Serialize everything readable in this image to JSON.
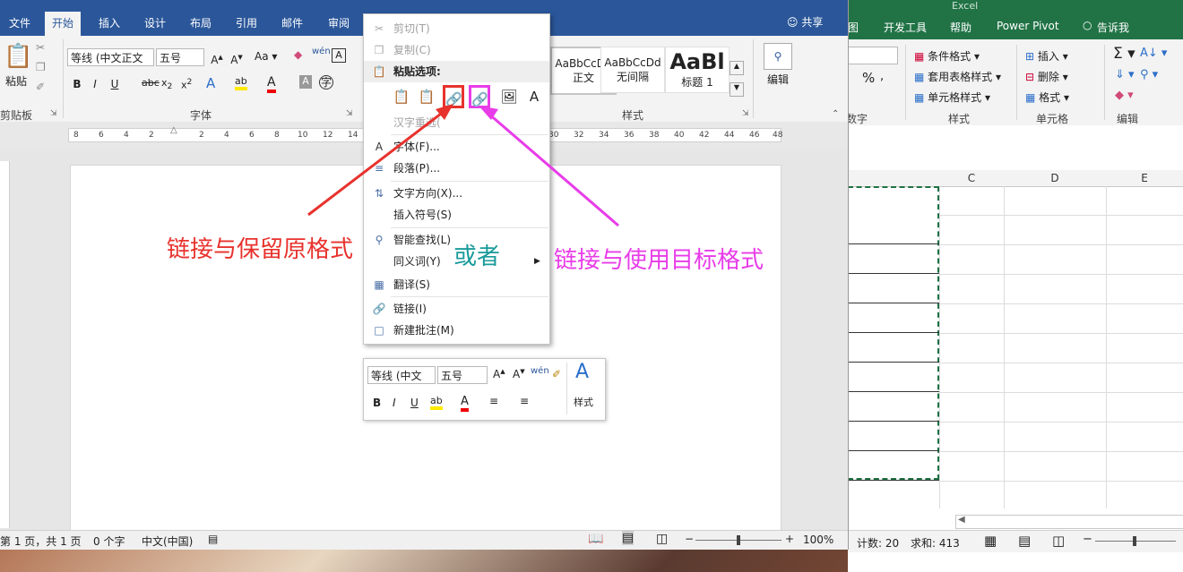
{
  "excel": {
    "tabs": [
      "图",
      "开发工具",
      "帮助",
      "Power Pivot",
      "告诉我"
    ],
    "title_fragment": "Excel",
    "ribbon": {
      "percent_symbol": "%",
      "number_group_label": "数字",
      "styles": {
        "conditional": "条件格式",
        "table_style": "套用表格样式",
        "cell_style": "单元格样式",
        "label": "样式"
      },
      "cells": {
        "insert": "插入",
        "delete": "删除",
        "format": "格式",
        "label": "单元格"
      },
      "editing": {
        "label": "编辑"
      }
    },
    "columns": [
      "C",
      "D",
      "E"
    ],
    "status": {
      "count": "计数: 20",
      "sum": "求和: 413"
    }
  },
  "word": {
    "tabs": [
      "文件",
      "开始",
      "插入",
      "设计",
      "布局",
      "引用",
      "邮件",
      "审阅"
    ],
    "share": "共享",
    "clipboard": {
      "paste": "粘贴",
      "label": "剪贴板"
    },
    "font": {
      "name": "等线 (中文正文",
      "size": "五号",
      "aa": "Aa",
      "label": "字体"
    },
    "styles": {
      "items": [
        {
          "preview": "AaBbCcDd",
          "name": "正文"
        },
        {
          "preview": "AaBbCcDd",
          "name": "无间隔"
        },
        {
          "preview": "AaBl",
          "name": "标题 1"
        }
      ],
      "label": "样式"
    },
    "editing": {
      "label": "编辑"
    },
    "ruler_ticks": [
      "8",
      "6",
      "4",
      "2",
      "2",
      "4",
      "6",
      "8",
      "10",
      "12",
      "14",
      "30",
      "32",
      "34",
      "36",
      "38",
      "40",
      "42",
      "44",
      "46",
      "48"
    ],
    "status": {
      "page": "第 1 页，共 1 页",
      "words": "0 个字",
      "lang": "中文(中国)",
      "zoom": "100%"
    }
  },
  "context_menu": {
    "cut": "剪切(T)",
    "copy": "复制(C)",
    "paste_options": "粘贴选项:",
    "reconvert": "汉字重选(",
    "font": "字体(F)...",
    "paragraph": "段落(P)...",
    "text_direction": "文字方向(X)...",
    "insert_symbol": "插入符号(S)",
    "smart_lookup": "智能查找(L)",
    "synonyms": "同义词(Y)",
    "translate": "翻译(S)",
    "link": "链接(I)",
    "new_comment": "新建批注(M)"
  },
  "mini_toolbar": {
    "font": "等线 (中文",
    "size": "五号",
    "styles": "样式"
  },
  "annotations": {
    "keep": "链接与保留原格式",
    "or": "或者",
    "dest": "链接与使用目标格式",
    "colors": {
      "red": "#e8322d",
      "magenta": "#e83ce8",
      "teal": "#1a9a9a"
    }
  },
  "colors": {
    "word_blue": "#2b579a",
    "excel_green": "#217346"
  }
}
